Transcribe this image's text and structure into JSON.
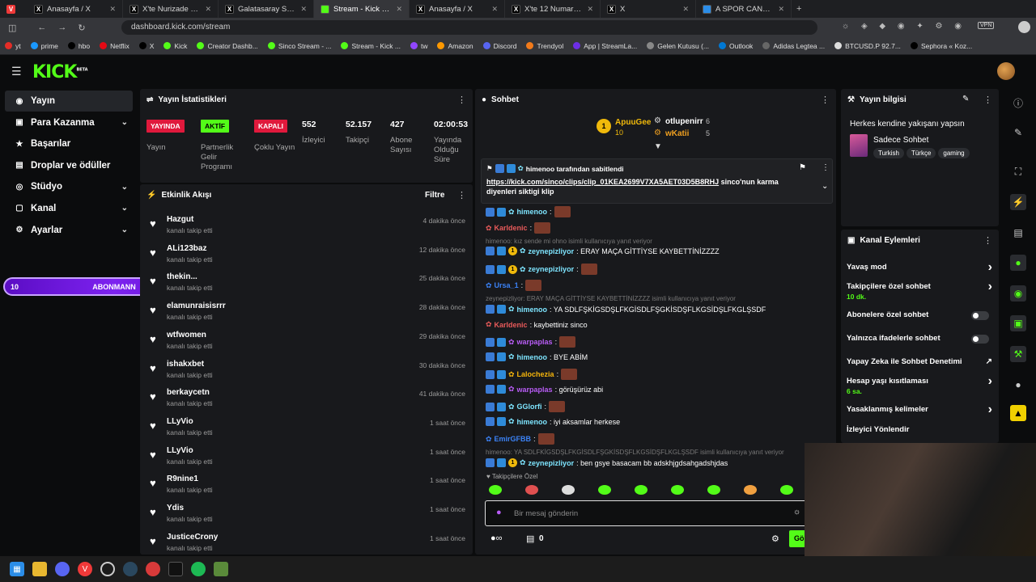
{
  "browser": {
    "tabs": [
      {
        "title": "Anasayfa / X",
        "icon": "x-icon"
      },
      {
        "title": "X'te Nurizade Ziya 🎶: \"Gal",
        "icon": "x-icon"
      },
      {
        "title": "Galatasaray SK (@Galatasa",
        "icon": "x-icon"
      },
      {
        "title": "Stream - Kick Dashboard",
        "icon": "kick-icon"
      },
      {
        "title": "Anasayfa / X",
        "icon": "x-icon"
      },
      {
        "title": "X'te 12 Numara ™: \"ÇOK M",
        "icon": "x-icon"
      },
      {
        "title": "X",
        "icon": "x-icon"
      },
      {
        "title": "A SPOR CANLI YAYIN - asp",
        "icon": "globe-icon"
      }
    ],
    "url": "dashboard.kick.com/stream",
    "bookmarks": [
      "yt",
      "prime",
      "hbo",
      "Netflix",
      "X",
      "Kick",
      "Creator Dashb...",
      "Sinco Stream - ...",
      "Stream - Kick ...",
      "tw",
      "Amazon",
      "Discord",
      "Trendyol",
      "App | StreamLa...",
      "Gelen Kutusu (...",
      "Outlook",
      "Adidas Legtea ...",
      "BTCUSD.P 92.7...",
      "Sephora « Koz..."
    ]
  },
  "logo": "KICK",
  "logo_sup": "BETA",
  "sidebar": {
    "items": [
      {
        "label": "Yayın",
        "icon": "◉",
        "selected": true,
        "chev": false
      },
      {
        "label": "Para Kazanma",
        "icon": "▣",
        "chev": true
      },
      {
        "label": "Başarılar",
        "icon": "★",
        "chev": false
      },
      {
        "label": "Droplar ve ödüller",
        "icon": "▤",
        "chev": false
      },
      {
        "label": "Stüdyo",
        "icon": "◎",
        "chev": true
      },
      {
        "label": "Kanal",
        "icon": "▢",
        "chev": true
      },
      {
        "label": "Ayarlar",
        "icon": "⚙",
        "chev": true
      }
    ]
  },
  "abone_bar": {
    "left": "10",
    "label": "ABONMANN",
    "right": "10"
  },
  "stats": {
    "title": "Yayın İstatistikleri",
    "badges": [
      {
        "label": "YAYINDA",
        "bg": "#e0193c",
        "fg": "#ffffff",
        "caption": "Yayın"
      },
      {
        "label": "AKTİF",
        "bg": "#53fc18",
        "fg": "#000000",
        "caption": "Partnerlik Gelir Programı"
      },
      {
        "label": "KAPALI",
        "bg": "#e0193c",
        "fg": "#ffffff",
        "caption": "Çoklu Yayın"
      }
    ],
    "metrics": [
      {
        "value": "552",
        "label": "İzleyici"
      },
      {
        "value": "52.157",
        "label": "Takipçi"
      },
      {
        "value": "427",
        "label": "Abone Sayısı"
      },
      {
        "value": "02:00:53",
        "label": "Yayında Olduğu Süre"
      }
    ]
  },
  "feed": {
    "title": "Etkinlik Akışı",
    "filter": "Filtre",
    "items": [
      {
        "name": "Hazgut",
        "sub": "kanalı takip etti",
        "time": "4 dakika önce"
      },
      {
        "name": "ALi123baz",
        "sub": "kanalı takip etti",
        "time": "12 dakika önce"
      },
      {
        "name": "thekin...",
        "sub": "kanalı takip etti",
        "time": "25 dakika önce"
      },
      {
        "name": "elamunraisisrrr",
        "sub": "kanalı takip etti",
        "time": "28 dakika önce"
      },
      {
        "name": "wtfwomen",
        "sub": "kanalı takip etti",
        "time": "29 dakika önce"
      },
      {
        "name": "ishakxbet",
        "sub": "kanalı takip etti",
        "time": "30 dakika önce"
      },
      {
        "name": "berkaycetn",
        "sub": "kanalı takip etti",
        "time": "41 dakika önce"
      },
      {
        "name": "LLyVio",
        "sub": "kanalı takip etti",
        "time": "1 saat önce"
      },
      {
        "name": "LLyVio",
        "sub": "kanalı takip etti",
        "time": "1 saat önce"
      },
      {
        "name": "R9nine1",
        "sub": "kanalı takip etti",
        "time": "1 saat önce"
      },
      {
        "name": "Ydis",
        "sub": "kanalı takip etti",
        "time": "1 saat önce"
      },
      {
        "name": "JusticeCrony",
        "sub": "kanalı takip etti",
        "time": "1 saat önce"
      }
    ]
  },
  "chat": {
    "title": "Sohbet",
    "leader1": {
      "name": "ApuuGee",
      "count": "10"
    },
    "leader2": {
      "name": "otlupenirr",
      "count": "6"
    },
    "leader3": {
      "name": "wKatii",
      "count": "5"
    },
    "pinned_by": "himenoo tarafından sabitlendi",
    "pinned_link": "https://kick.com/sinco/clips/clip_01KEA2699V7XA5AET03D5B8RHJ",
    "pinned_text": " sinco'nun karma diyenleri siktigi klip",
    "messages": [
      {
        "type": "msg",
        "user": "himenoo",
        "color": "#7ee5ff",
        "text": ":"
      },
      {
        "type": "msg",
        "user": "Karldenic",
        "color": "#e85a5a",
        "text": ":"
      },
      {
        "type": "reply",
        "text": "himenoo: kız sende mi ohno isimli kullanıcıya yanıt veriyor"
      },
      {
        "type": "msg",
        "user": "zeynepizliyor",
        "color": "#7ee5ff",
        "text": ": ERAY MAÇA GİTTİYSE KAYBETTİNİZZZZ"
      },
      {
        "type": "msg",
        "user": "zeynepizliyor",
        "color": "#7ee5ff",
        "text": ":"
      },
      {
        "type": "msg",
        "user": "Ursa_1",
        "color": "#3b82f6",
        "text": ":"
      },
      {
        "type": "reply",
        "text": "zeynepizliyor: ERAY MAÇA GİTTİYSE KAYBETTİNİZZZZ isimli kullanıcıya yanıt veriyor"
      },
      {
        "type": "msg",
        "user": "himenoo",
        "color": "#7ee5ff",
        "text": ": YA SDLFŞKİGSDŞLFKGİSDLFŞGKİSDŞFLKGSİDŞLFKGLŞSDF"
      },
      {
        "type": "msg",
        "user": "Karldenic",
        "color": "#e85a5a",
        "text": ": kaybettiniz sinco"
      },
      {
        "type": "msg",
        "user": "warpaplas",
        "color": "#b85cf5",
        "text": ":"
      },
      {
        "type": "msg",
        "user": "himenoo",
        "color": "#7ee5ff",
        "text": ": BYE ABİM"
      },
      {
        "type": "msg",
        "user": "Lalochezia",
        "color": "#f5b50b",
        "text": ":"
      },
      {
        "type": "msg",
        "user": "warpaplas",
        "color": "#b85cf5",
        "text": ": görüşürüz abi"
      },
      {
        "type": "msg",
        "user": "GGlorfi",
        "color": "#7ee5ff",
        "text": ":"
      },
      {
        "type": "msg",
        "user": "himenoo",
        "color": "#7ee5ff",
        "text": ": iyi aksamlar herkese"
      },
      {
        "type": "msg",
        "user": "EmirGFBB",
        "color": "#3b82f6",
        "text": ":"
      },
      {
        "type": "reply",
        "text": "himenoo: YA SDLFKİGSDŞLFKGİSDLFŞGKİSDŞFLKGSİDŞFLKGLŞSDF isimli kullanıcıya yanıt veriyor"
      },
      {
        "type": "msg",
        "user": "zeynepizliyor",
        "color": "#7ee5ff",
        "text": ": ben gsye basacam bb adskhjgdsahgadshjdas"
      }
    ],
    "followers_only": "Takipçilere Özel",
    "input_placeholder": "Bir mesaj gönderin",
    "count": "0",
    "send": "Gö"
  },
  "info": {
    "title": "Yayın bilgisi",
    "stream_title": "Herkes kendine yakışanı yapsın",
    "category": "Sadece Sohbet",
    "tags": [
      "Turkish",
      "Türkçe",
      "gaming"
    ]
  },
  "actions": {
    "title": "Kanal Eylemleri",
    "items": [
      {
        "label": "Yavaş mod",
        "sub": "",
        "control": "arrow"
      },
      {
        "label": "Takipçilere özel sohbet",
        "sub": "10 dk.",
        "control": "arrow"
      },
      {
        "label": "Abonelere özel sohbet",
        "sub": "",
        "control": "toggle"
      },
      {
        "label": "Yalnızca ifadelerle sohbet",
        "sub": "",
        "control": "toggle"
      },
      {
        "label": "Yapay Zeka ile Sohbet Denetimi",
        "sub": "",
        "control": "ext"
      },
      {
        "label": "Hesap yaşı kısıtlaması",
        "sub": "6 sa.",
        "control": "arrow"
      },
      {
        "label": "Yasaklanmış kelimeler",
        "sub": "",
        "control": "arrow"
      },
      {
        "label": "İzleyici Yönlendir",
        "sub": "",
        "control": "none"
      }
    ]
  }
}
